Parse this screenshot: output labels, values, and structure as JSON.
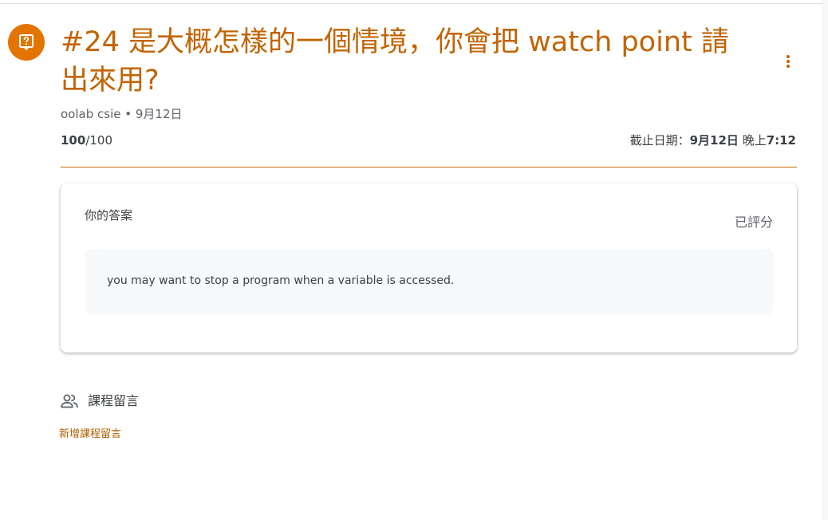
{
  "assignment": {
    "title": "#24 是大概怎樣的一個情境，你會把 watch point 請出來用?",
    "icon": "assignment-question-icon",
    "accent_color": "#e37400",
    "title_color": "#c26401"
  },
  "meta": {
    "author": "oolab csie",
    "separator": " • ",
    "date": "9月12日",
    "score": "100",
    "score_total": "/100",
    "due_label": "截止日期：",
    "due_date": "9月12日",
    "due_period": " 晚上",
    "due_time": "7:12"
  },
  "your_work": {
    "title": "你的答案",
    "status": "已評分",
    "answer": "you may want to stop a program when a variable is accessed."
  },
  "comments": {
    "header": "課程留言",
    "icon": "people-icon",
    "add_label": "新增課程留言"
  },
  "menu": {
    "icon": "more-vert-icon"
  }
}
